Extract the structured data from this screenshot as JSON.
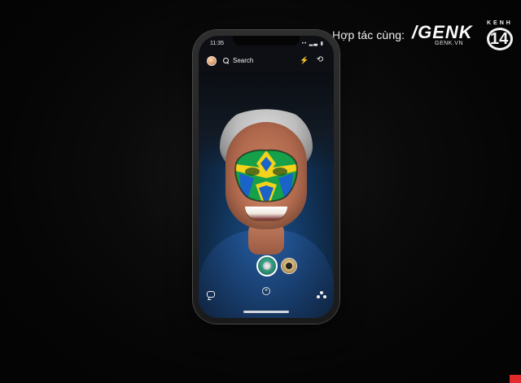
{
  "overlay": {
    "credit_text": "Hợp tác cùng:",
    "genk_logo_text": "/GENK",
    "genk_subtext": "GENK.VN",
    "kenh14_top": "KENH",
    "kenh14_number": "14"
  },
  "phone": {
    "status_time": "11:35",
    "status_icons": "•• ▂▃ ▮",
    "topbar": {
      "search_label": "Search",
      "search_icon": "search-icon",
      "avatar_icon": "avatar-icon",
      "flash_icon": "flash-off-icon",
      "flip_icon": "camera-flip-icon"
    },
    "lenses": {
      "selected_lens_icon": "green-face-lens-icon",
      "next_lens_icon": "sloth-lens-icon",
      "close_icon": "close-icon"
    },
    "bottom_icons": {
      "chat_icon": "chat-icon",
      "friends_icon": "friends-icon"
    }
  },
  "colors": {
    "background": "#070707",
    "mask_green": "#16a04a",
    "mask_yellow": "#f2d21b",
    "mask_blue": "#1a63c8"
  }
}
